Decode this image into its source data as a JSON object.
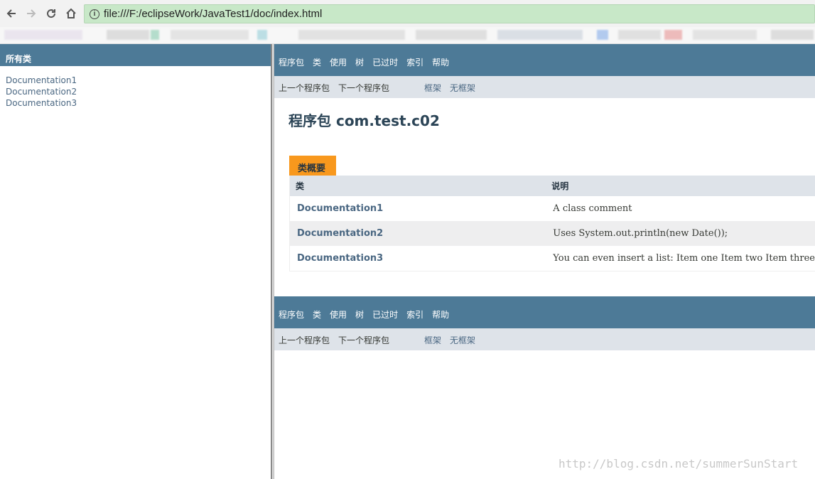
{
  "browser": {
    "url": "file:///F:/eclipseWork/JavaTest1/doc/index.html",
    "icons": [
      "back-arrow-icon",
      "forward-arrow-icon",
      "reload-icon",
      "home-icon",
      "info-icon"
    ],
    "url_bar_color": "#c8e8c8"
  },
  "left_frame": {
    "header": "所有类",
    "classes": [
      "Documentation1",
      "Documentation2",
      "Documentation3"
    ]
  },
  "top_nav": {
    "items": [
      "程序包",
      "类",
      "使用",
      "树",
      "已过时",
      "索引",
      "帮助"
    ]
  },
  "sub_nav": {
    "prev_package": "上一个程序包",
    "next_package": "下一个程序包",
    "frames": "框架",
    "no_frames": "无框架"
  },
  "content": {
    "title": "程序包 com.test.c02",
    "tab_label": "类概要",
    "columns": [
      "类",
      "说明"
    ],
    "rows": [
      {
        "class": "Documentation1",
        "description": "A class comment"
      },
      {
        "class": "Documentation2",
        "description": "Uses System.out.println(new Date());"
      },
      {
        "class": "Documentation3",
        "description": "You can even insert a list: Item one Item two Item three"
      }
    ]
  },
  "watermark": "http://blog.csdn.net/summerSunStart",
  "colors": {
    "nav_bar": "#4d7a97",
    "sub_nav": "#dee3e9",
    "tab": "#f8981d",
    "link": "#4a6782"
  }
}
